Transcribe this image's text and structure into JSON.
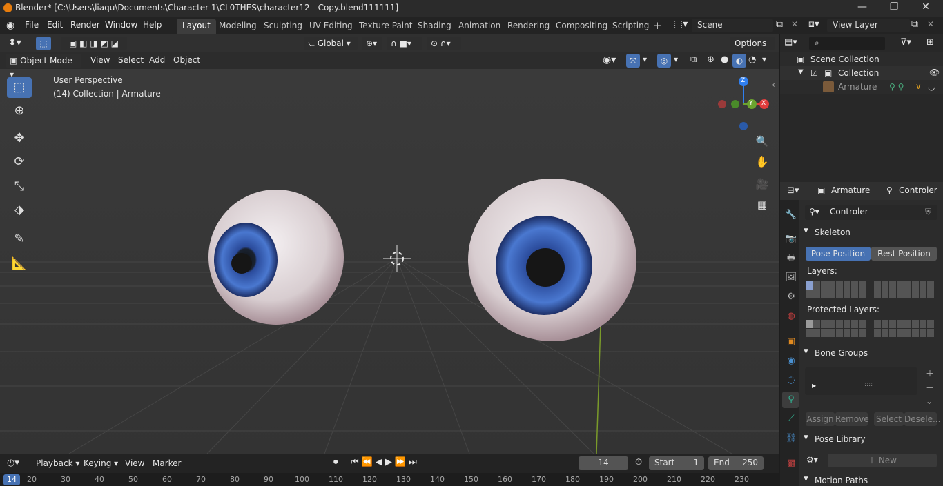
{
  "title": "Blender* [C:\\Users\\liaqu\\Documents\\Character 1\\CL0THES\\character12 - Copy.blend111111]",
  "window_controls": {
    "minimize": "—",
    "maximize": "❐",
    "close": "✕"
  },
  "menu": [
    "File",
    "Edit",
    "Render",
    "Window",
    "Help"
  ],
  "workspaces": [
    "Layout",
    "Modeling",
    "Sculpting",
    "UV Editing",
    "Texture Paint",
    "Shading",
    "Animation",
    "Rendering",
    "Compositing",
    "Scripting"
  ],
  "active_workspace": "Layout",
  "add_workspace": "+",
  "scene": "Scene",
  "view_layer": "View Layer",
  "toolbar": {
    "transform_orientation": "Global",
    "options": "Options"
  },
  "viewport_header": {
    "mode": "Object Mode",
    "menus": [
      "View",
      "Select",
      "Add",
      "Object"
    ]
  },
  "viewport": {
    "perspective": "User Perspective",
    "context": "(14) Collection | Armature",
    "axes": {
      "z": "Z",
      "y": "Y",
      "x": "X"
    }
  },
  "outliner": {
    "root": "Scene Collection",
    "collection": "Collection",
    "object": "Armature"
  },
  "properties": {
    "breadcrumb_object": "Armature",
    "breadcrumb_data": "Controler",
    "data_name": "Controler",
    "skeleton": {
      "title": "Skeleton",
      "pose_position": "Pose Position",
      "rest_position": "Rest Position",
      "layers": "Layers:",
      "protected_layers": "Protected Layers:"
    },
    "bone_groups": {
      "title": "Bone Groups",
      "assign": "Assign",
      "remove": "Remove",
      "select": "Select",
      "deselect": "Desele..."
    },
    "pose_library": {
      "title": "Pose Library",
      "new": "New"
    },
    "motion_paths": {
      "title": "Motion Paths"
    }
  },
  "timeline": {
    "menus": [
      "Playback",
      "Keying",
      "View",
      "Marker"
    ],
    "current_frame": "14",
    "start_label": "Start",
    "start": "1",
    "end_label": "End",
    "end": "250",
    "ruler": [
      "20",
      "30",
      "40",
      "50",
      "60",
      "70",
      "80",
      "90",
      "100",
      "110",
      "120",
      "130",
      "140",
      "150",
      "160",
      "170",
      "180",
      "190",
      "200",
      "210",
      "220",
      "230"
    ],
    "frame_marker": "14"
  },
  "colors": {
    "accent": "#4772b3",
    "z_axis": "#2f7ff0",
    "y_axis": "#6ba42f",
    "x_axis": "#e03c3c",
    "iris": "#3a5bb0"
  }
}
